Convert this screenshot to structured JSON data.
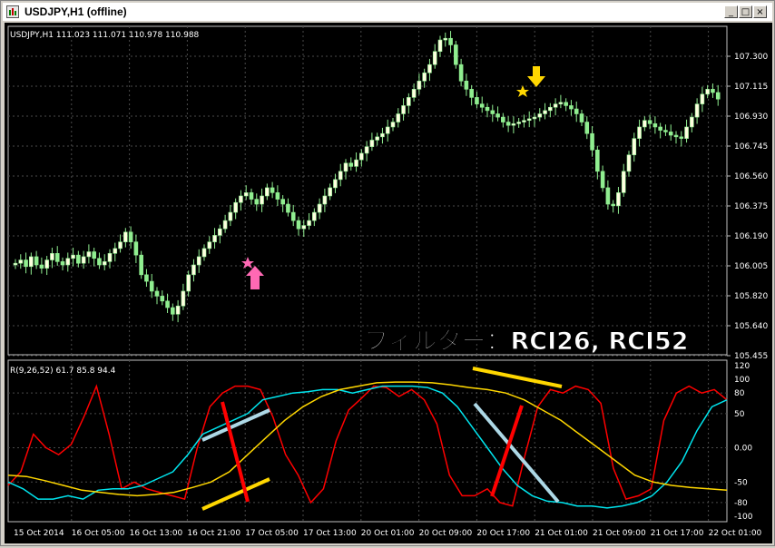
{
  "window": {
    "title": "USDJPY,H1 (offline)",
    "buttons": {
      "minimize": "_",
      "maximize": "□",
      "close": "×"
    }
  },
  "price_chart": {
    "info": "USDJPY,H1  111.023 111.071 110.978 110.988",
    "annotation": "フィルター：RCI26, RCI52",
    "price_labels": [
      "107.300",
      "107.115",
      "106.930",
      "106.745",
      "106.560",
      "106.375",
      "106.190",
      "106.005",
      "105.820",
      "105.640",
      "105.455"
    ]
  },
  "indicator": {
    "info": "R(9,26,52) 61.7 85.8 94.4",
    "levels": [
      "120",
      "100",
      "80",
      "50",
      "0.00",
      "-50",
      "-80",
      "-100"
    ]
  },
  "time_labels": [
    "15 Oct 2014",
    "16 Oct 05:00",
    "16 Oct 13:00",
    "16 Oct 21:00",
    "17 Oct 05:00",
    "17 Oct 13:00",
    "20 Oct 01:00",
    "20 Oct 09:00",
    "20 Oct 17:00",
    "21 Oct 01:00",
    "21 Oct 09:00",
    "21 Oct 17:00",
    "22 Oct 01:00"
  ],
  "colors": {
    "bull": "#ffffe0",
    "bear": "#90ee90",
    "rci9": "#ff0000",
    "rci26": "#00e5ee",
    "rci52": "#ffd700",
    "grid": "#4a4a4a",
    "sell_arrow": "#ffd700",
    "buy_arrow": "#ff69b4"
  },
  "chart_data": [
    {
      "type": "candlestick",
      "symbol": "USDJPY",
      "timeframe": "H1",
      "title": "USDJPY,H1",
      "ylim": [
        105.455,
        107.4
      ],
      "close": [
        105.99,
        106.01,
        105.97,
        106.03,
        105.98,
        105.96,
        106.01,
        106.05,
        106.0,
        105.98,
        106.02,
        106.04,
        105.99,
        106.03,
        106.06,
        106.02,
        105.98,
        106.0,
        106.05,
        106.08,
        106.12,
        106.18,
        106.12,
        106.04,
        105.92,
        105.88,
        105.82,
        105.79,
        105.76,
        105.72,
        105.68,
        105.73,
        105.82,
        105.92,
        105.98,
        106.03,
        106.08,
        106.12,
        106.16,
        106.2,
        106.25,
        106.3,
        106.36,
        106.4,
        106.42,
        106.38,
        106.35,
        106.4,
        106.45,
        106.42,
        106.38,
        106.35,
        106.3,
        106.25,
        106.2,
        106.22,
        106.25,
        106.3,
        106.35,
        106.4,
        106.45,
        106.5,
        106.55,
        106.6,
        106.58,
        106.62,
        106.66,
        106.7,
        106.74,
        106.76,
        106.78,
        106.82,
        106.85,
        106.9,
        106.95,
        107.0,
        107.05,
        107.1,
        107.15,
        107.2,
        107.28,
        107.35,
        107.36,
        107.32,
        107.2,
        107.1,
        107.05,
        107.0,
        106.96,
        106.94,
        106.92,
        106.9,
        106.88,
        106.85,
        106.83,
        106.84,
        106.85,
        106.86,
        106.87,
        106.88,
        106.9,
        106.92,
        106.94,
        106.96,
        106.97,
        106.95,
        106.93,
        106.9,
        106.85,
        106.78,
        106.68,
        106.55,
        106.45,
        106.35,
        106.34,
        106.42,
        106.55,
        106.65,
        106.75,
        106.82,
        106.86,
        106.84,
        106.82,
        106.8,
        106.79,
        106.77,
        106.76,
        106.75,
        106.82,
        106.88,
        106.96,
        107.02,
        107.05,
        107.03,
        106.99
      ]
    },
    {
      "type": "line",
      "title": "R(9,26,52)",
      "ylim": [
        -100,
        120
      ],
      "series": [
        {
          "name": "RCI 9",
          "values": [
            -55,
            -35,
            20,
            0,
            -10,
            5,
            45,
            90,
            20,
            -60,
            -50,
            -60,
            -65,
            -70,
            -75,
            0,
            60,
            80,
            90,
            90,
            85,
            45,
            -10,
            -40,
            -80,
            -60,
            10,
            55,
            72,
            90,
            88,
            75,
            85,
            70,
            35,
            -40,
            -70,
            -70,
            -60,
            -80,
            -85,
            -10,
            60,
            85,
            80,
            90,
            85,
            65,
            -30,
            -75,
            -70,
            -60,
            40,
            80,
            90,
            80,
            85,
            70
          ]
        },
        {
          "name": "RCI 26",
          "values": [
            -50,
            -60,
            -75,
            -75,
            -70,
            -75,
            -62,
            -60,
            -60,
            -55,
            -45,
            -35,
            -10,
            20,
            30,
            40,
            50,
            70,
            75,
            80,
            82,
            85,
            85,
            80,
            85,
            90,
            90,
            90,
            88,
            80,
            60,
            30,
            0,
            -30,
            -55,
            -70,
            -78,
            -80,
            -85,
            -85,
            -88,
            -85,
            -80,
            -70,
            -50,
            -20,
            25,
            60,
            70
          ]
        },
        {
          "name": "RCI 52",
          "values": [
            -40,
            -42,
            -48,
            -55,
            -62,
            -65,
            -68,
            -70,
            -68,
            -65,
            -58,
            -50,
            -35,
            -10,
            15,
            40,
            60,
            75,
            85,
            90,
            95,
            96,
            96,
            95,
            92,
            88,
            85,
            80,
            70,
            55,
            40,
            20,
            0,
            -20,
            -40,
            -50,
            -55,
            -58,
            -60,
            -62
          ]
        }
      ]
    }
  ]
}
